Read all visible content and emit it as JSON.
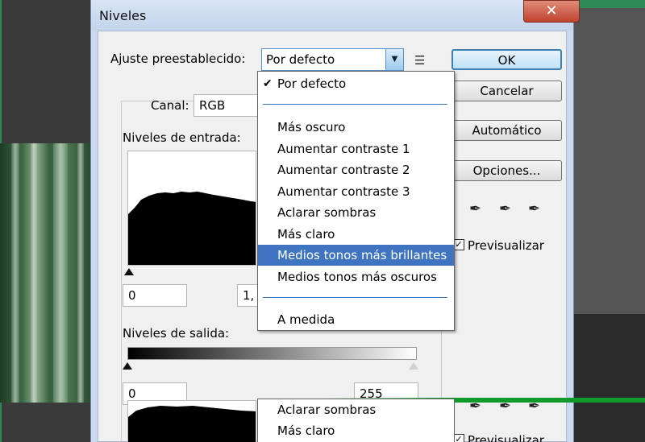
{
  "dialog": {
    "title": "Niveles",
    "close_glyph": "✕"
  },
  "preset": {
    "label": "Ajuste preestablecido:",
    "value": "Por defecto",
    "menu_icon": "☰"
  },
  "buttons": {
    "ok": "OK",
    "cancel": "Cancelar",
    "auto": "Automático",
    "options": "Opciones..."
  },
  "channel": {
    "label": "Canal:",
    "value": "RGB"
  },
  "input_levels": {
    "label": "Niveles de entrada:",
    "black": "0",
    "gamma": "1,"
  },
  "output_levels": {
    "label": "Niveles de salida:",
    "black": "0",
    "white": "255"
  },
  "preview": {
    "label": "Previsualizar",
    "checked": "✓",
    "label_bottom": "Previsualizar"
  },
  "dropdown": {
    "checkmark": "✔",
    "items": [
      "Por defecto",
      "Más oscuro",
      "Aumentar contraste 1",
      "Aumentar contraste 2",
      "Aumentar contraste 3",
      "Aclarar sombras",
      "Más claro",
      "Medios tonos más brillantes",
      "Medios tonos más oscuros",
      "A medida"
    ],
    "selected_index": 7
  },
  "dropdown_bottom": {
    "items": [
      "Aclarar sombras",
      "Más claro"
    ]
  },
  "colors": {
    "selection": "#3f74c1",
    "dialog_frame": "#c9d9ee",
    "close_button": "#c0422e"
  }
}
